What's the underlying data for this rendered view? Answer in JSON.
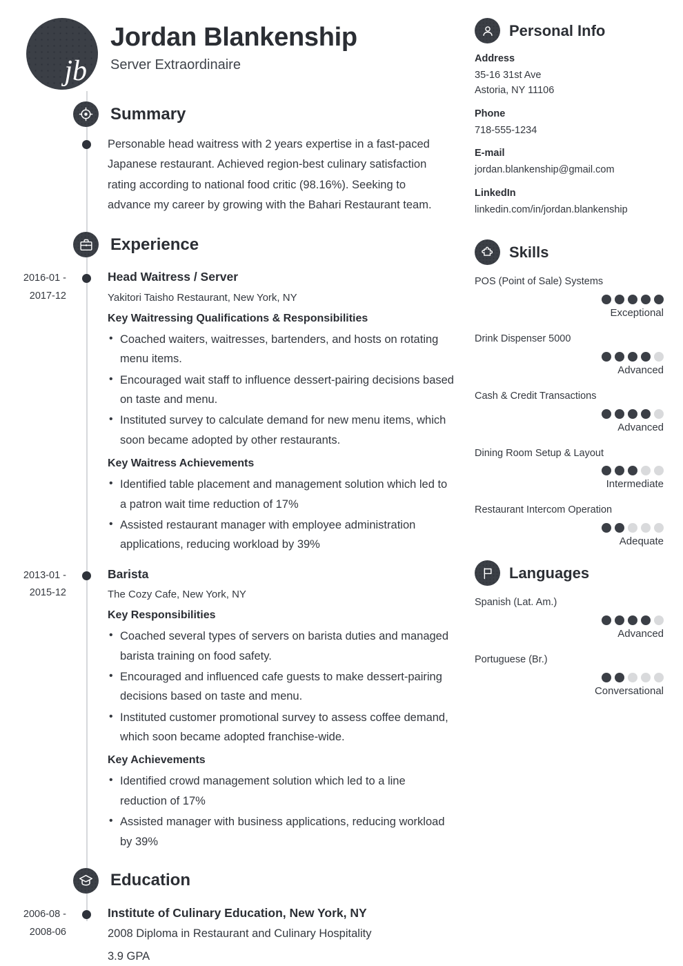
{
  "header": {
    "initials": "jb",
    "name": "Jordan Blankenship",
    "title": "Server Extraordinaire"
  },
  "summary": {
    "heading": "Summary",
    "icon": "target-icon",
    "text": "Personable head waitress with 2 years expertise in a fast-paced Japanese restaurant. Achieved region-best culinary satisfaction rating according to national food critic (98.16%). Seeking to advance my career by growing with the Bahari Restaurant team."
  },
  "experience": {
    "heading": "Experience",
    "icon": "briefcase-icon",
    "entries": [
      {
        "dates_start": "2016-01 -",
        "dates_end": "2017-12",
        "role": "Head Waitress / Server",
        "org": "Yakitori Taisho Restaurant, New York, NY",
        "group1_head": "Key Waitressing Qualifications & Responsibilities",
        "group1_bullets": [
          "Coached waiters, waitresses, bartenders, and hosts on rotating menu items.",
          "Encouraged wait staff to influence dessert-pairing decisions based on taste and menu.",
          "Instituted survey to calculate demand for new menu items, which soon became adopted by other restaurants."
        ],
        "group2_head": "Key Waitress Achievements",
        "group2_bullets": [
          "Identified table placement and management solution which led to a patron wait time reduction of 17%",
          "Assisted restaurant manager with employee administration applications, reducing workload by 39%"
        ]
      },
      {
        "dates_start": "2013-01 -",
        "dates_end": "2015-12",
        "role": "Barista",
        "org": "The Cozy Cafe, New York, NY",
        "group1_head": "Key Responsibilities",
        "group1_bullets": [
          "Coached several types of servers on barista duties and managed barista training on food safety.",
          "Encouraged and influenced cafe guests to make dessert-pairing decisions based on taste and menu.",
          "Instituted customer promotional survey to assess coffee demand, which soon became adopted franchise-wide."
        ],
        "group2_head": "Key Achievements",
        "group2_bullets": [
          "Identified crowd management solution which led to a line reduction of 17%",
          "Assisted manager with business applications, reducing workload by 39%"
        ]
      }
    ]
  },
  "education": {
    "heading": "Education",
    "icon": "graduation-cap-icon",
    "entries": [
      {
        "dates_start": "2006-08 -",
        "dates_end": "2008-06",
        "school": "Institute of Culinary Education, New York, NY",
        "degree": "2008 Diploma in Restaurant and Culinary Hospitality",
        "gpa": "3.9 GPA"
      }
    ]
  },
  "personal_info": {
    "heading": "Personal Info",
    "icon": "person-icon",
    "blocks": [
      {
        "label": "Address",
        "line1": "35-16 31st Ave",
        "line2": "Astoria, NY 11106"
      },
      {
        "label": "Phone",
        "line1": "718-555-1234",
        "line2": ""
      },
      {
        "label": "E-mail",
        "line1": "jordan.blankenship@gmail.com",
        "line2": ""
      },
      {
        "label": "LinkedIn",
        "line1": "linkedin.com/in/jordan.blankenship",
        "line2": ""
      }
    ]
  },
  "skills": {
    "heading": "Skills",
    "icon": "puzzle-piece-icon",
    "max": 5,
    "items": [
      {
        "name": "POS (Point of Sale) Systems",
        "rating": 5,
        "level": "Exceptional"
      },
      {
        "name": "Drink Dispenser 5000",
        "rating": 4,
        "level": "Advanced"
      },
      {
        "name": "Cash & Credit Transactions",
        "rating": 4,
        "level": "Advanced"
      },
      {
        "name": "Dining Room Setup & Layout",
        "rating": 3,
        "level": "Intermediate"
      },
      {
        "name": "Restaurant Intercom Operation",
        "rating": 2,
        "level": "Adequate"
      }
    ]
  },
  "languages": {
    "heading": "Languages",
    "icon": "flag-icon",
    "max": 5,
    "items": [
      {
        "name": "Spanish (Lat. Am.)",
        "rating": 4,
        "level": "Advanced"
      },
      {
        "name": "Portuguese (Br.)",
        "rating": 2,
        "level": "Conversational"
      }
    ]
  },
  "colors": {
    "dark": "#3b3f46",
    "text": "#34383f",
    "heading": "#2b2e34",
    "dot_off": "#d9dadc",
    "timeline": "#d6d8db"
  }
}
